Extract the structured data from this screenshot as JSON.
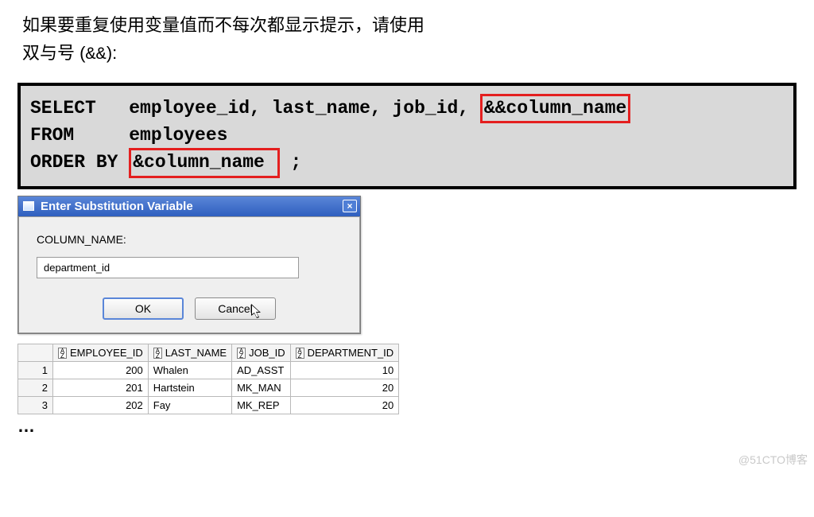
{
  "intro": {
    "line1": "如果要重复使用变量值而不每次都显示提示，请使用",
    "line2_prefix": "双与号 (",
    "line2_code": "&&",
    "line2_suffix": "):"
  },
  "code": {
    "kw_select": "SELECT",
    "select_cols": "   employee_id, last_name, job_id, ",
    "hl_select": "&&column_name",
    "kw_from": "FROM",
    "from_tbl": "     employees",
    "kw_order": "ORDER BY ",
    "hl_order": "&column_name ",
    "order_tail": " ;"
  },
  "dialog": {
    "title": "Enter Substitution Variable",
    "close_icon": "×",
    "label": "COLUMN_NAME:",
    "input_value": "department_id",
    "ok": "OK",
    "cancel": "Cancel"
  },
  "table": {
    "sort_glyph": "A\nZ",
    "headers": [
      "EMPLOYEE_ID",
      "LAST_NAME",
      "JOB_ID",
      "DEPARTMENT_ID"
    ],
    "rows": [
      {
        "n": "1",
        "emp": "200",
        "last": "Whalen",
        "job": "AD_ASST",
        "dept": "10"
      },
      {
        "n": "2",
        "emp": "201",
        "last": "Hartstein",
        "job": "MK_MAN",
        "dept": "20"
      },
      {
        "n": "3",
        "emp": "202",
        "last": "Fay",
        "job": "MK_REP",
        "dept": "20"
      }
    ]
  },
  "ellipsis": "…",
  "watermark": "@51CTO博客"
}
